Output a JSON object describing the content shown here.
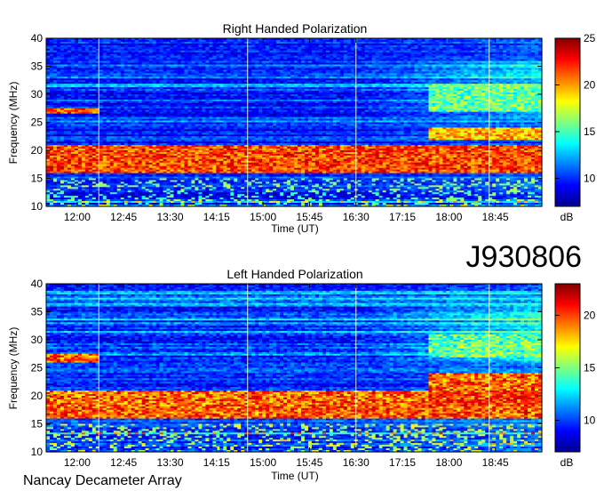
{
  "figure": {
    "event_id": "J930806",
    "instrument": "Nancay Decameter Array"
  },
  "chart_data": [
    {
      "type": "heatmap",
      "title": "Right Handed Polarization",
      "xlabel": "Time (UT)",
      "ylabel": "Frequency (MHz)",
      "x_ticks": [
        "12:00",
        "12:45",
        "13:30",
        "14:15",
        "15:00",
        "15:45",
        "16:30",
        "17:15",
        "18:00",
        "18:45"
      ],
      "y_ticks": [
        10,
        15,
        20,
        25,
        30,
        35,
        40
      ],
      "ylim": [
        10,
        40
      ],
      "colorbar": {
        "label": "dB",
        "range": [
          7,
          25
        ],
        "ticks": [
          10,
          15,
          20,
          25
        ]
      },
      "emission_bands": [
        {
          "freq_MHz": [
            16,
            21
          ],
          "level_dB": 24,
          "time": "11:30–19:30"
        },
        {
          "freq_MHz": [
            26.5,
            27.5
          ],
          "level_dB": 24,
          "time": "11:30–12:20"
        },
        {
          "freq_MHz": [
            22,
            24
          ],
          "level_dB": 22,
          "time": "17:40–19:30"
        },
        {
          "freq_MHz": [
            27,
            32
          ],
          "level_dB": 18,
          "time": "17:40–19:30"
        }
      ],
      "colormap": "jet",
      "grid": false
    },
    {
      "type": "heatmap",
      "title": "Left Handed Polarization",
      "xlabel": "Time (UT)",
      "ylabel": "Frequency (MHz)",
      "x_ticks": [
        "12:00",
        "12:45",
        "13:30",
        "14:15",
        "15:00",
        "15:45",
        "16:30",
        "17:15",
        "18:00",
        "18:45"
      ],
      "y_ticks": [
        10,
        15,
        20,
        25,
        30,
        35,
        40
      ],
      "ylim": [
        10,
        40
      ],
      "colorbar": {
        "label": "dB",
        "range": [
          7,
          23
        ],
        "ticks": [
          10,
          15,
          20
        ]
      },
      "emission_bands": [
        {
          "freq_MHz": [
            16,
            21
          ],
          "level_dB": 22,
          "time": "11:30–19:30"
        },
        {
          "freq_MHz": [
            26,
            27.5
          ],
          "level_dB": 22,
          "time": "11:30–12:20"
        },
        {
          "freq_MHz": [
            18,
            24
          ],
          "level_dB": 22,
          "time": "17:40–19:30"
        },
        {
          "freq_MHz": [
            27,
            31
          ],
          "level_dB": 17,
          "time": "17:40–19:30"
        }
      ],
      "colormap": "jet",
      "grid": false
    }
  ]
}
